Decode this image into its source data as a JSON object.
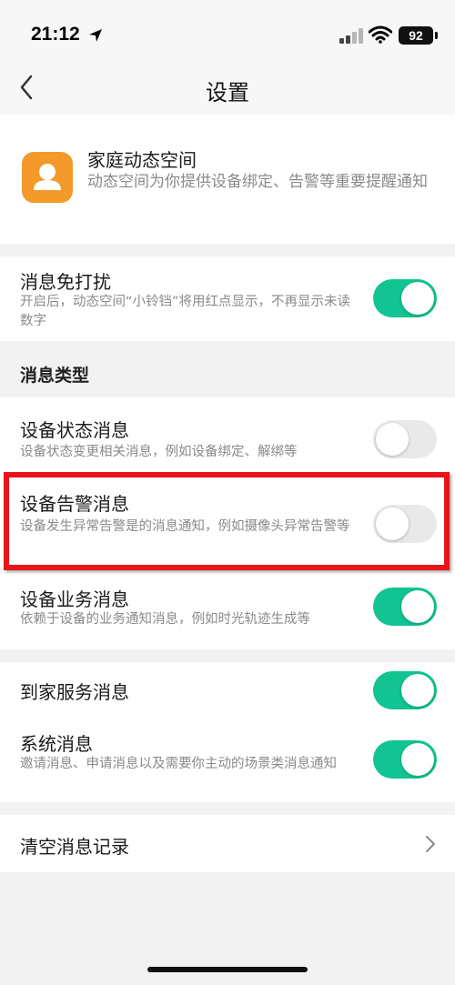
{
  "status_bar": {
    "time": "21:12",
    "battery": "92"
  },
  "nav": {
    "title": "设置"
  },
  "app": {
    "name": "家庭动态空间",
    "description": "动态空间为你提供设备绑定、告警等重要提醒通知"
  },
  "dnd": {
    "title": "消息免打扰",
    "description": "开启后，动态空间“小铃铛”将用红点显示，不再显示未读数字",
    "enabled": true
  },
  "message_types": {
    "section_label": "消息类型",
    "items": [
      {
        "title": "设备状态消息",
        "description": "设备状态变更相关消息，例如设备绑定、解绑等",
        "enabled": false
      },
      {
        "title": "设备告警消息",
        "description": "设备发生异常告警是的消息通知，例如摄像头异常告警等",
        "enabled": false
      },
      {
        "title": "设备业务消息",
        "description": "依赖于设备的业务通知消息，例如时光轨迹生成等",
        "enabled": true
      }
    ]
  },
  "other_types": {
    "items": [
      {
        "title": "到家服务消息",
        "enabled": true
      },
      {
        "title": "系统消息",
        "description": "邀请消息、申请消息以及需要你主动的场景类消息通知",
        "enabled": true
      }
    ]
  },
  "clear": {
    "label": "清空消息记录"
  },
  "colors": {
    "toggle_on": "#12c492",
    "toggle_off": "#e9e9e9",
    "highlight": "#e8141a",
    "app_icon": "#f39a2b"
  },
  "icons": [
    "location-arrow-icon",
    "cellular-signal-icon",
    "wifi-icon",
    "battery-icon",
    "back-chevron-icon",
    "user-avatar-icon",
    "chevron-right-icon"
  ]
}
